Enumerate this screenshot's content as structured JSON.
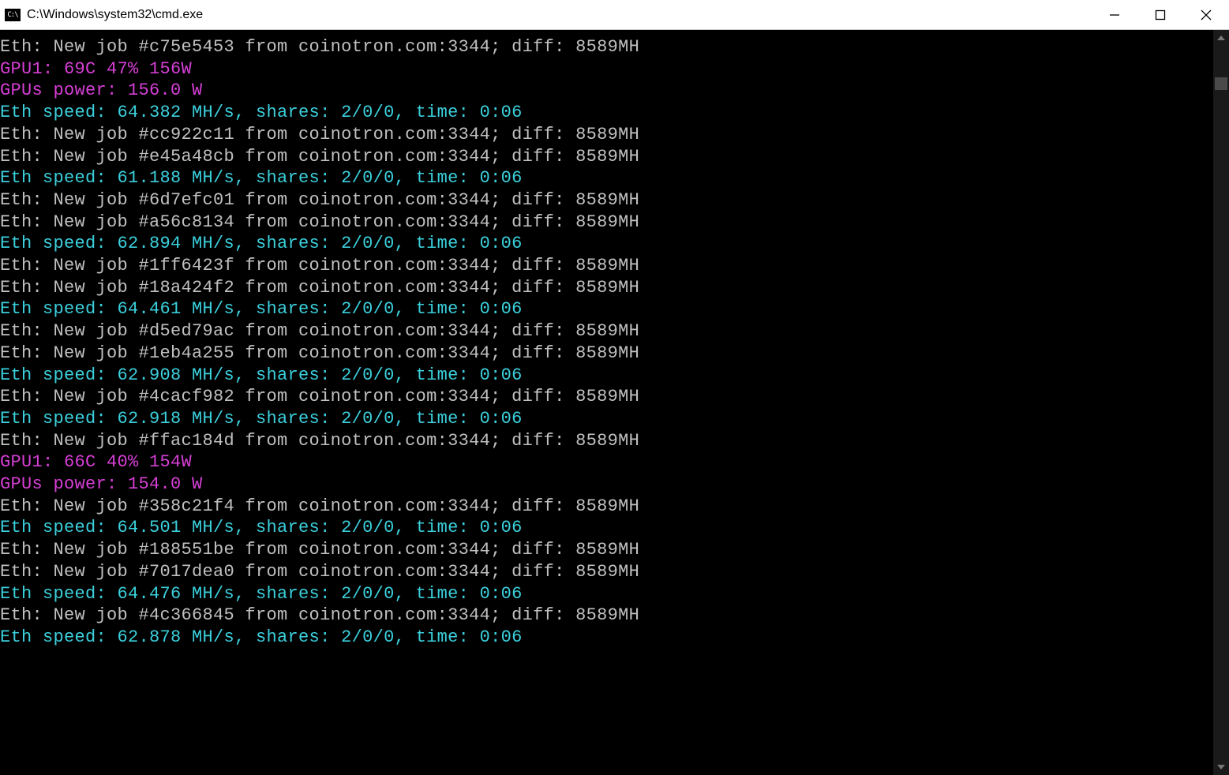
{
  "window": {
    "title": "C:\\Windows\\system32\\cmd.exe"
  },
  "lines": [
    {
      "cls": "line",
      "text": "Eth: New job #c75e5453 from coinotron.com:3344; diff: 8589MH"
    },
    {
      "cls": "magenta-line",
      "label": "GPU1: ",
      "value": "69C 47% 156W"
    },
    {
      "cls": "power-line",
      "label": "GPUs power: ",
      "value": "156.0 W"
    },
    {
      "cls": "cyan",
      "text": "Eth speed: 64.382 MH/s, shares: 2/0/0, time: 0:06"
    },
    {
      "cls": "line",
      "text": "Eth: New job #cc922c11 from coinotron.com:3344; diff: 8589MH"
    },
    {
      "cls": "line",
      "text": "Eth: New job #e45a48cb from coinotron.com:3344; diff: 8589MH"
    },
    {
      "cls": "cyan",
      "text": "Eth speed: 61.188 MH/s, shares: 2/0/0, time: 0:06"
    },
    {
      "cls": "line",
      "text": "Eth: New job #6d7efc01 from coinotron.com:3344; diff: 8589MH"
    },
    {
      "cls": "line",
      "text": "Eth: New job #a56c8134 from coinotron.com:3344; diff: 8589MH"
    },
    {
      "cls": "cyan",
      "text": "Eth speed: 62.894 MH/s, shares: 2/0/0, time: 0:06"
    },
    {
      "cls": "line",
      "text": "Eth: New job #1ff6423f from coinotron.com:3344; diff: 8589MH"
    },
    {
      "cls": "line",
      "text": "Eth: New job #18a424f2 from coinotron.com:3344; diff: 8589MH"
    },
    {
      "cls": "cyan",
      "text": "Eth speed: 64.461 MH/s, shares: 2/0/0, time: 0:06"
    },
    {
      "cls": "line",
      "text": "Eth: New job #d5ed79ac from coinotron.com:3344; diff: 8589MH"
    },
    {
      "cls": "line",
      "text": "Eth: New job #1eb4a255 from coinotron.com:3344; diff: 8589MH"
    },
    {
      "cls": "cyan",
      "text": "Eth speed: 62.908 MH/s, shares: 2/0/0, time: 0:06"
    },
    {
      "cls": "line",
      "text": "Eth: New job #4cacf982 from coinotron.com:3344; diff: 8589MH"
    },
    {
      "cls": "cyan",
      "text": "Eth speed: 62.918 MH/s, shares: 2/0/0, time: 0:06"
    },
    {
      "cls": "line",
      "text": "Eth: New job #ffac184d from coinotron.com:3344; diff: 8589MH"
    },
    {
      "cls": "magenta-line",
      "label": "GPU1: ",
      "value": "66C 40% 154W"
    },
    {
      "cls": "power-line",
      "label": "GPUs power: ",
      "value": "154.0 W"
    },
    {
      "cls": "line",
      "text": "Eth: New job #358c21f4 from coinotron.com:3344; diff: 8589MH"
    },
    {
      "cls": "cyan",
      "text": "Eth speed: 64.501 MH/s, shares: 2/0/0, time: 0:06"
    },
    {
      "cls": "line",
      "text": "Eth: New job #188551be from coinotron.com:3344; diff: 8589MH"
    },
    {
      "cls": "line",
      "text": "Eth: New job #7017dea0 from coinotron.com:3344; diff: 8589MH"
    },
    {
      "cls": "cyan",
      "text": "Eth speed: 64.476 MH/s, shares: 2/0/0, time: 0:06"
    },
    {
      "cls": "line",
      "text": "Eth: New job #4c366845 from coinotron.com:3344; diff: 8589MH"
    },
    {
      "cls": "cyan",
      "text": "Eth speed: 62.878 MH/s, shares: 2/0/0, time: 0:06"
    }
  ]
}
